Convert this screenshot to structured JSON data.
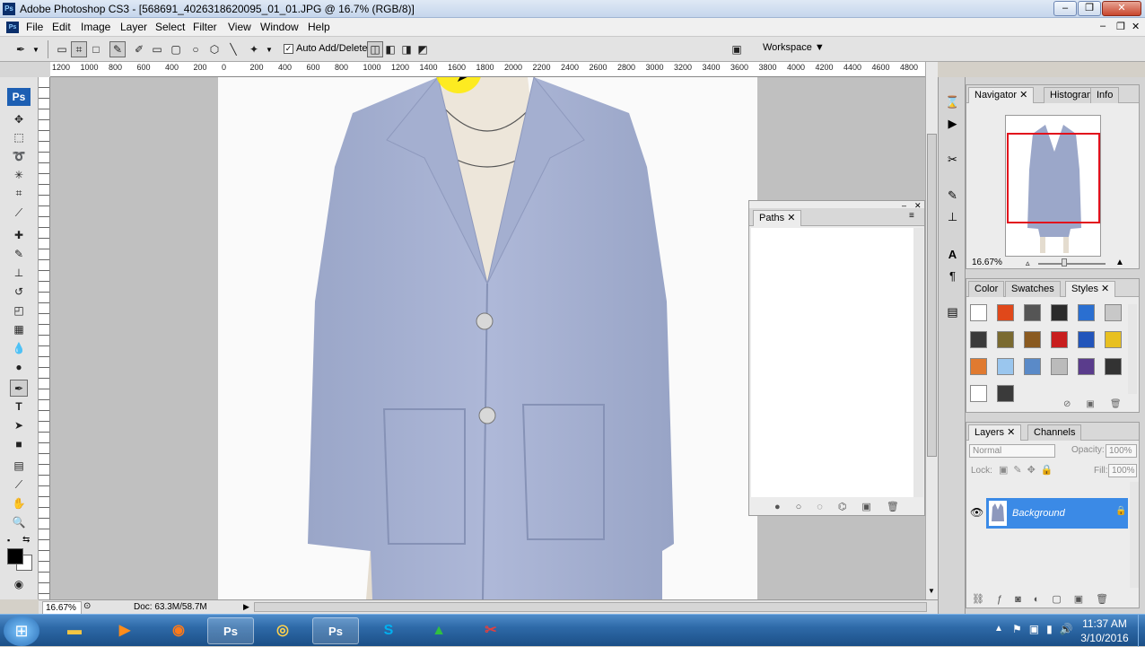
{
  "window": {
    "title": "Adobe Photoshop CS3 - [568691_4026318620095_01_01.JPG @ 16.7% (RGB/8)]",
    "app_icon": "Ps",
    "min": "‒",
    "restore": "❐",
    "close": "✕"
  },
  "menu": {
    "items": [
      "File",
      "Edit",
      "Image",
      "Layer",
      "Select",
      "Filter",
      "View",
      "Window",
      "Help"
    ],
    "doc_controls": [
      "‒",
      "❐",
      "✕"
    ]
  },
  "options": {
    "auto_add_delete_label": "Auto Add/Delete",
    "auto_add_delete_checked": true,
    "workspace_label": "Workspace ▼"
  },
  "ruler": {
    "h_labels": [
      "1200",
      "1000",
      "800",
      "600",
      "400",
      "200",
      "0",
      "200",
      "400",
      "600",
      "800",
      "1000",
      "1200",
      "1400",
      "1600",
      "1800",
      "2000",
      "2200",
      "2400",
      "2600",
      "2800",
      "3000",
      "3200",
      "3400",
      "3600",
      "3800",
      "4000",
      "4200",
      "4400",
      "4600",
      "4800"
    ]
  },
  "toolbox": {
    "logo": "Ps"
  },
  "status": {
    "zoom": "16.67%",
    "doc_size": "Doc: 63.3M/58.7M"
  },
  "paths_panel": {
    "tab": "Paths"
  },
  "navigator_panel": {
    "tabs": [
      "Navigator",
      "Histogram",
      "Info"
    ],
    "zoom": "16.67%"
  },
  "styles_panel": {
    "tabs": [
      "Color",
      "Swatches",
      "Styles"
    ],
    "swatch_colors": [
      "#ffffff",
      "#e0481a",
      "#555555",
      "#2b2b2b",
      "#2a6fd1",
      "#c8c8c8",
      "#3a3a3a",
      "#7a6a30",
      "#8a5a20",
      "#c81e1e",
      "#2255bb",
      "#e8c020",
      "#e07a30",
      "#9ac6ee",
      "#5a8ac8",
      "#bbbbbb",
      "#5a3c8c",
      "#333333",
      "#ffffff",
      "#3a3a3a"
    ]
  },
  "layers_panel": {
    "tabs": [
      "Layers",
      "Channels"
    ],
    "blend_mode": "Normal",
    "opacity_label": "Opacity:",
    "opacity_value": "100%",
    "lock_label": "Lock:",
    "fill_label": "Fill:",
    "fill_value": "100%",
    "layer_name": "Background"
  },
  "taskbar": {
    "apps": [
      "start",
      "explorer",
      "media",
      "firefox",
      "photoshop",
      "chrome",
      "photoshop2",
      "skype",
      "app1",
      "app2"
    ],
    "time": "11:37 AM",
    "date": "3/10/2016"
  }
}
